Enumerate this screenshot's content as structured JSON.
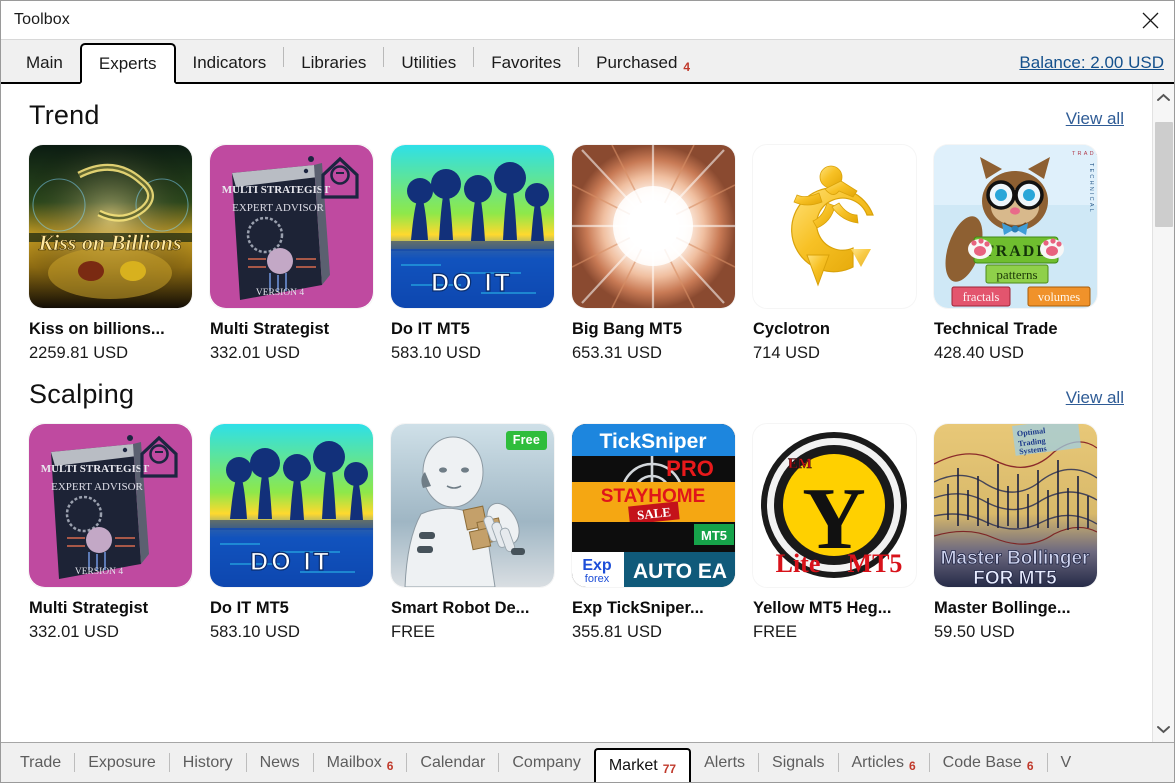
{
  "window": {
    "title": "Toolbox",
    "close_icon": "close-icon"
  },
  "tabs": {
    "items": [
      {
        "label": "Main",
        "active": false,
        "badge": ""
      },
      {
        "label": "Experts",
        "active": true,
        "badge": ""
      },
      {
        "label": "Indicators",
        "active": false,
        "badge": ""
      },
      {
        "label": "Libraries",
        "active": false,
        "badge": ""
      },
      {
        "label": "Utilities",
        "active": false,
        "badge": ""
      },
      {
        "label": "Favorites",
        "active": false,
        "badge": ""
      },
      {
        "label": "Purchased",
        "active": false,
        "badge": "4"
      }
    ],
    "balance_label": "Balance: 2.00 USD",
    "link_color": "#14508c",
    "badge_color": "#c0392b"
  },
  "sections": [
    {
      "title": "Trend",
      "view_all": "View all",
      "products": [
        {
          "name": "Kiss on billions...",
          "price": "2259.81 USD",
          "art": "kiss",
          "badge": ""
        },
        {
          "name": "Multi Strategist",
          "price": "332.01 USD",
          "art": "multi",
          "badge": ""
        },
        {
          "name": "Do IT MT5",
          "price": "583.10 USD",
          "art": "doit",
          "badge": ""
        },
        {
          "name": "Big Bang MT5",
          "price": "653.31 USD",
          "art": "bigbang",
          "badge": ""
        },
        {
          "name": "Cyclotron",
          "price": "714 USD",
          "art": "cyclotron",
          "badge": ""
        },
        {
          "name": "Technical Trade",
          "price": "428.40 USD",
          "art": "technical",
          "badge": ""
        }
      ]
    },
    {
      "title": "Scalping",
      "view_all": "View all",
      "products": [
        {
          "name": "Multi Strategist",
          "price": "332.01 USD",
          "art": "multi",
          "badge": ""
        },
        {
          "name": "Do IT MT5",
          "price": "583.10 USD",
          "art": "doit",
          "badge": ""
        },
        {
          "name": "Smart Robot De...",
          "price": "FREE",
          "art": "robot",
          "badge": "Free"
        },
        {
          "name": "Exp TickSniper...",
          "price": "355.81 USD",
          "art": "ticksniper",
          "badge": ""
        },
        {
          "name": "Yellow MT5 Heg...",
          "price": "FREE",
          "art": "yellow",
          "badge": ""
        },
        {
          "name": "Master Bollinge...",
          "price": "59.50 USD",
          "art": "bollinger",
          "badge": ""
        }
      ]
    }
  ],
  "scrollbar": {
    "up_icon": "chevron-up-icon",
    "down_icon": "chevron-down-icon"
  },
  "bottom_tabs": {
    "items": [
      {
        "label": "Trade",
        "badge": "",
        "active": false
      },
      {
        "label": "Exposure",
        "badge": "",
        "active": false
      },
      {
        "label": "History",
        "badge": "",
        "active": false
      },
      {
        "label": "News",
        "badge": "",
        "active": false
      },
      {
        "label": "Mailbox",
        "badge": "6",
        "active": false
      },
      {
        "label": "Calendar",
        "badge": "",
        "active": false
      },
      {
        "label": "Company",
        "badge": "",
        "active": false
      },
      {
        "label": "Market",
        "badge": "77",
        "active": true
      },
      {
        "label": "Alerts",
        "badge": "",
        "active": false
      },
      {
        "label": "Signals",
        "badge": "",
        "active": false
      },
      {
        "label": "Articles",
        "badge": "6",
        "active": false
      },
      {
        "label": "Code Base",
        "badge": "6",
        "active": false
      },
      {
        "label": "V",
        "badge": "",
        "active": false
      }
    ]
  },
  "art_text": {
    "kiss": "Kiss on Billions",
    "multi_line1": "MULTI STRATEGIST",
    "multi_line2": "EXPERT ADVISOR",
    "multi_line3": "VERSION 4",
    "doit": "DO IT",
    "technical_trade": "TRADE",
    "technical_patterns": "patterns",
    "technical_fractals": "fractals",
    "technical_volumes": "volumes",
    "technical_side": "TECHNICAL",
    "technical_top": "TRADE",
    "ticksniper_title": "TickSniper",
    "ticksniper_pro": "PRO",
    "ticksniper_stayhome": "STAYHOME",
    "ticksniper_sale": "SALE",
    "ticksniper_mt5": "MT5",
    "ticksniper_exp": "Exp",
    "ticksniper_forex": "forex",
    "ticksniper_auto": "AUTO EA",
    "yellow_em": "EM",
    "yellow_y": "Y",
    "yellow_lite": "Lite",
    "yellow_mt5": "MT5",
    "bollinger_l1": "Master  Bollinger",
    "bollinger_l2": "FOR MT5",
    "bollinger_ots": "Optimal Trading Systems"
  }
}
